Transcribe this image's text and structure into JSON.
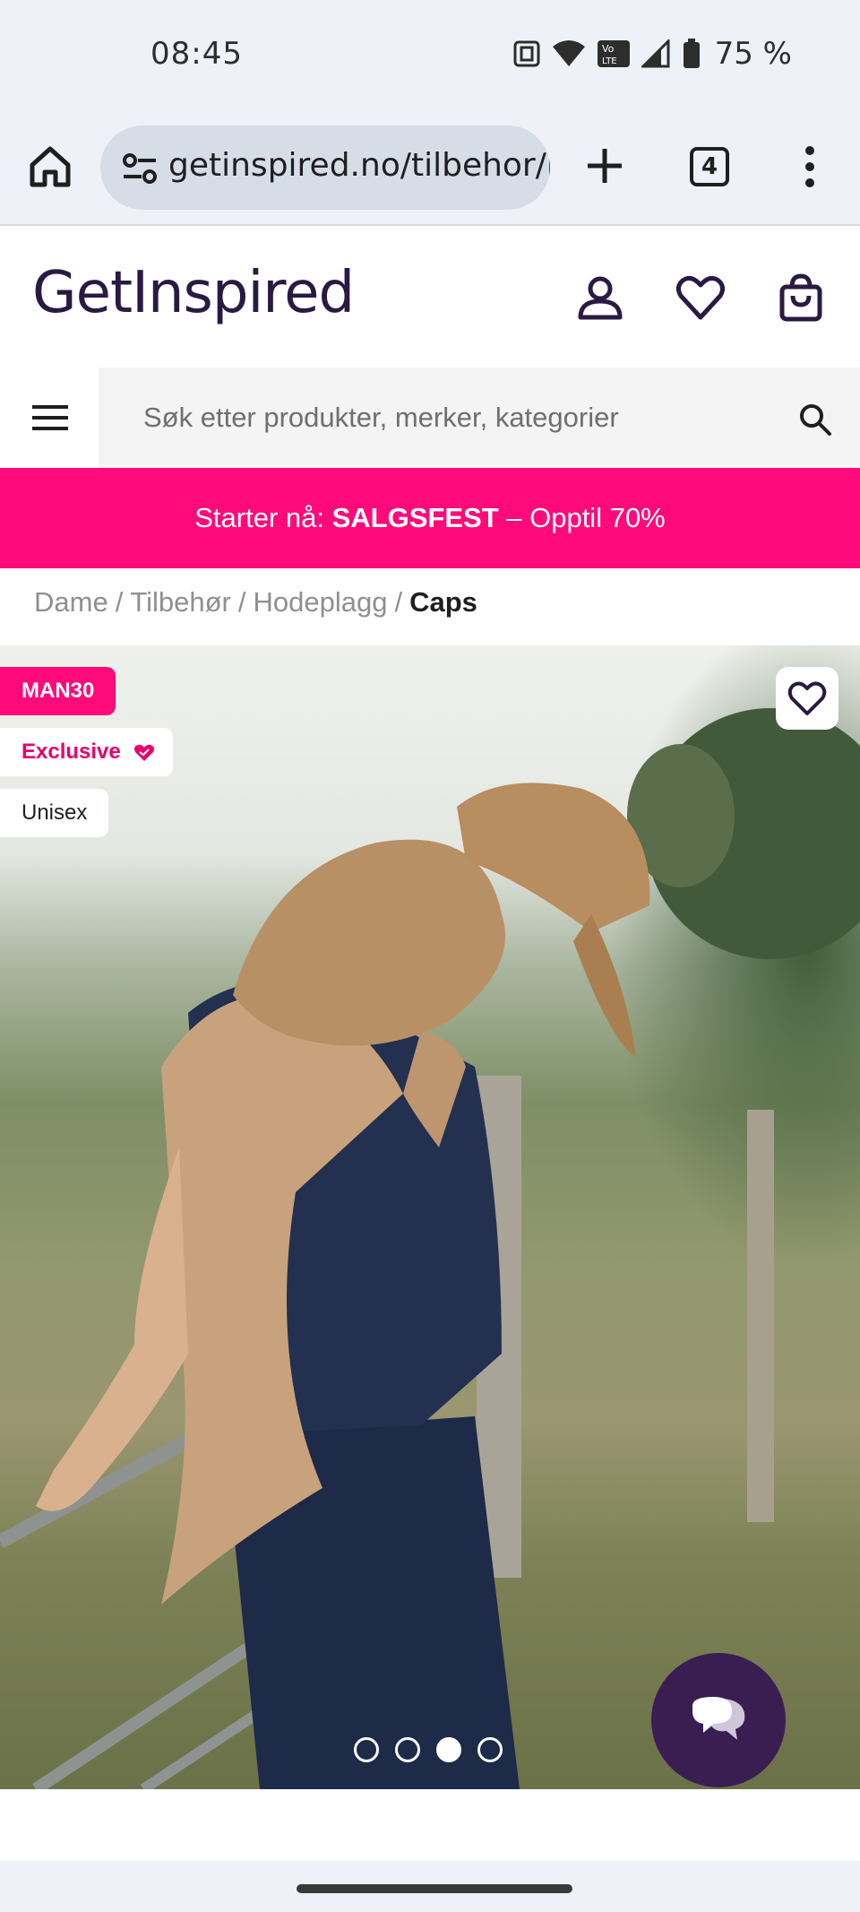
{
  "status_bar": {
    "time": "08:45",
    "battery": "75 %"
  },
  "browser": {
    "url": "getinspired.no/tilbehor/hodeplagg/caps",
    "tab_count": "4"
  },
  "site": {
    "logo": "GetInspired",
    "search_placeholder": "Søk etter produkter, merker, kategorier"
  },
  "promo": {
    "prefix": "Starter nå:",
    "highlight": "SALGSFEST",
    "suffix": "– Opptil 70%",
    "background": "#ff0a7a"
  },
  "breadcrumb": {
    "items": [
      "Dame",
      "Tilbehør",
      "Hodeplagg"
    ],
    "current": "Caps"
  },
  "product": {
    "badges": {
      "discount": "MAN30",
      "exclusive": "Exclusive",
      "gender": "Unisex"
    },
    "carousel": {
      "total": 4,
      "active": 3
    }
  },
  "colors": {
    "brand_dark": "#2a1a43",
    "accent_pink": "#ff0a7a",
    "chat_button": "#3a1e52"
  }
}
